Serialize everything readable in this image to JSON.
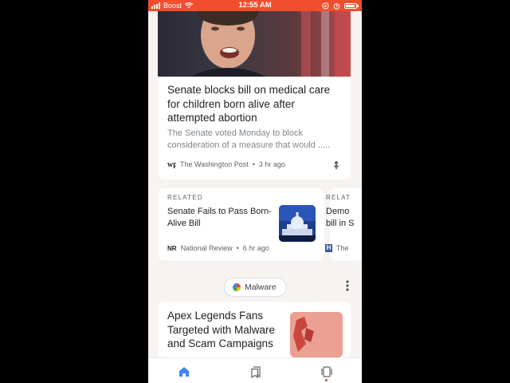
{
  "status_bar": {
    "carrier": "Boost",
    "time": "12:55 AM"
  },
  "card1": {
    "headline": "Senate blocks bill on medical care for children born alive after attempted abortion",
    "snippet": "The Senate voted Monday to block consideration of a measure that would .....",
    "source": "The Washington Post",
    "time": "3 hr ago",
    "source_logo_text": "wp"
  },
  "related": [
    {
      "label": "RELATED",
      "title": "Senate Fails to Pass Born-Alive Bill",
      "source_logo": "NR",
      "source": "National Review",
      "time": "6 hr ago"
    },
    {
      "label": "RELAT",
      "title": "Demo bill in S",
      "source_logo": "H",
      "source": "The"
    }
  ],
  "topic_chip": {
    "label": "Malware"
  },
  "card2": {
    "headline": "Apex Legends Fans Targeted with Malware and Scam Campaigns"
  },
  "colors": {
    "status_bar": "#f24e2e",
    "accent_blue": "#4285f4",
    "notification_dot": "#e53935"
  }
}
